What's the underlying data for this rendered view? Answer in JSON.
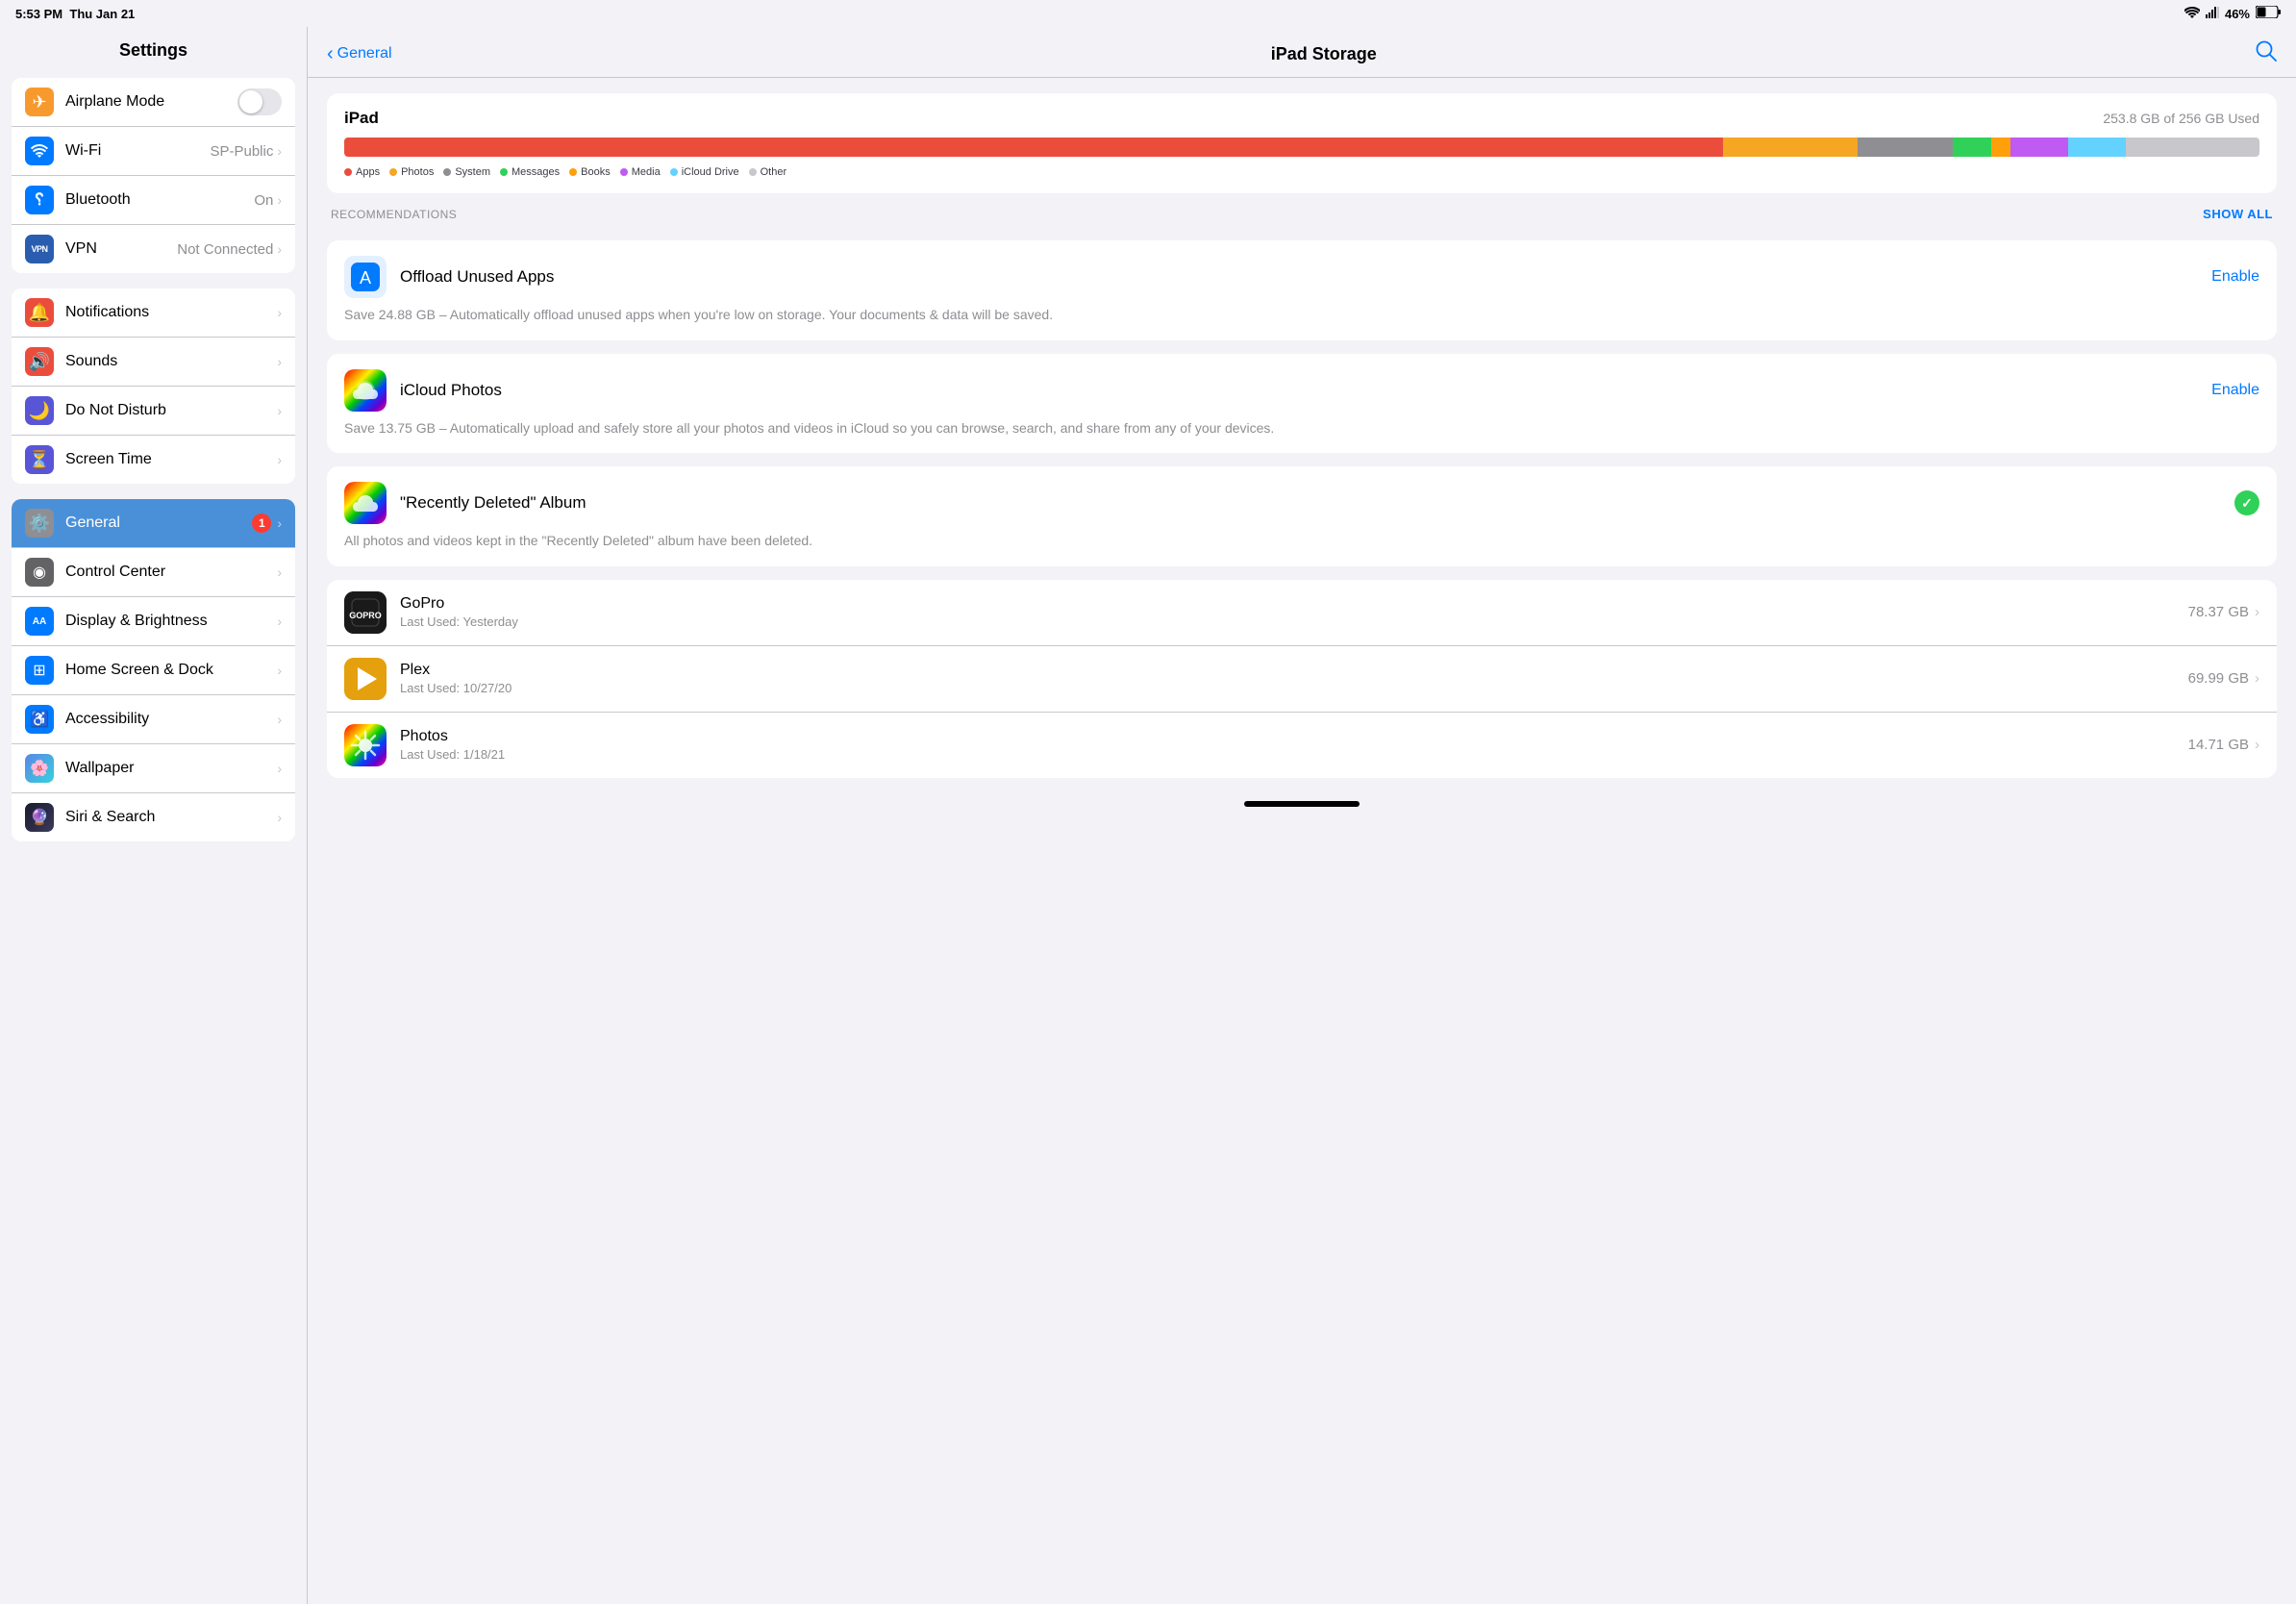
{
  "statusBar": {
    "time": "5:53 PM",
    "date": "Thu Jan 21",
    "wifi": "wifi",
    "signal": "signal",
    "battery": "46%"
  },
  "leftPanel": {
    "title": "Settings",
    "groups": [
      {
        "id": "connectivity",
        "rows": [
          {
            "id": "airplane",
            "icon": "✈️",
            "iconBg": "#f8992e",
            "label": "Airplane Mode",
            "type": "toggle",
            "toggleOn": false
          },
          {
            "id": "wifi",
            "icon": "📶",
            "iconBg": "#007aff",
            "label": "Wi-Fi",
            "value": "SP-Public",
            "type": "nav"
          },
          {
            "id": "bluetooth",
            "icon": "Ⓑ",
            "iconBg": "#007aff",
            "label": "Bluetooth",
            "value": "On",
            "type": "nav"
          },
          {
            "id": "vpn",
            "icon": "VPN",
            "iconBg": "#2a5db0",
            "label": "VPN",
            "value": "Not Connected",
            "type": "nav"
          }
        ]
      },
      {
        "id": "notifications",
        "rows": [
          {
            "id": "notifications",
            "icon": "🔔",
            "iconBg": "#eb4d3d",
            "label": "Notifications",
            "type": "nav"
          },
          {
            "id": "sounds",
            "icon": "🔊",
            "iconBg": "#eb4d3d",
            "label": "Sounds",
            "type": "nav"
          },
          {
            "id": "donotdisturb",
            "icon": "🌙",
            "iconBg": "#5856d6",
            "label": "Do Not Disturb",
            "type": "nav"
          },
          {
            "id": "screentime",
            "icon": "⏳",
            "iconBg": "#5856d6",
            "label": "Screen Time",
            "type": "nav"
          }
        ]
      },
      {
        "id": "general",
        "rows": [
          {
            "id": "general",
            "icon": "⚙️",
            "iconBg": "#8e8e93",
            "label": "General",
            "badge": "1",
            "type": "nav",
            "active": true
          },
          {
            "id": "controlcenter",
            "icon": "◉",
            "iconBg": "#636366",
            "label": "Control Center",
            "type": "nav"
          },
          {
            "id": "displaybrightness",
            "icon": "AA",
            "iconBg": "#007aff",
            "label": "Display & Brightness",
            "type": "nav"
          },
          {
            "id": "homescreendock",
            "icon": "⊞",
            "iconBg": "#007aff",
            "label": "Home Screen & Dock",
            "type": "nav"
          },
          {
            "id": "accessibility",
            "icon": "♿",
            "iconBg": "#007aff",
            "label": "Accessibility",
            "type": "nav"
          },
          {
            "id": "wallpaper",
            "icon": "🌸",
            "iconBg": "#007aff",
            "label": "Wallpaper",
            "type": "nav"
          },
          {
            "id": "sirisearch",
            "icon": "🔮",
            "iconBg": "#1a1a2e",
            "label": "Siri & Search",
            "type": "nav"
          }
        ]
      }
    ]
  },
  "rightPanel": {
    "backLabel": "General",
    "title": "iPad Storage",
    "storage": {
      "device": "iPad",
      "usageText": "253.8 GB of 256 GB Used",
      "bars": [
        {
          "id": "apps",
          "color": "#eb4d3d",
          "pct": 72
        },
        {
          "id": "photos",
          "color": "#f5a623",
          "pct": 7
        },
        {
          "id": "system",
          "color": "#8e8e93",
          "pct": 5
        },
        {
          "id": "messages",
          "color": "#30d158",
          "pct": 2
        },
        {
          "id": "books",
          "color": "#ff9f0a",
          "pct": 2
        },
        {
          "id": "media",
          "color": "#bf5af2",
          "pct": 3
        },
        {
          "id": "icloudDrive",
          "color": "#64d2ff",
          "pct": 3
        },
        {
          "id": "other",
          "color": "#c7c7cc",
          "pct": 5
        }
      ],
      "legend": [
        {
          "label": "Apps",
          "color": "#eb4d3d"
        },
        {
          "label": "Photos",
          "color": "#f5a623"
        },
        {
          "label": "System",
          "color": "#8e8e93"
        },
        {
          "label": "Messages",
          "color": "#30d158"
        },
        {
          "label": "Books",
          "color": "#ff9f0a"
        },
        {
          "label": "Media",
          "color": "#bf5af2"
        },
        {
          "label": "iCloud Drive",
          "color": "#64d2ff"
        },
        {
          "label": "Other",
          "color": "#c7c7cc"
        }
      ]
    },
    "recommendations": {
      "sectionLabel": "Recommendations",
      "showAllLabel": "SHOW ALL",
      "items": [
        {
          "id": "offload",
          "iconColor": "#007aff",
          "title": "Offload Unused Apps",
          "actionLabel": "Enable",
          "description": "Save 24.88 GB – Automatically offload unused apps when you're low on storage. Your documents & data will be saved.",
          "type": "action"
        },
        {
          "id": "icloudphotos",
          "title": "iCloud Photos",
          "actionLabel": "Enable",
          "description": "Save 13.75 GB – Automatically upload and safely store all your photos and videos in iCloud so you can browse, search, and share from any of your devices.",
          "type": "action"
        },
        {
          "id": "recentlydeleted",
          "title": "\"Recently Deleted\" Album",
          "description": "All photos and videos kept in the \"Recently Deleted\" album have been deleted.",
          "type": "done"
        }
      ]
    },
    "apps": [
      {
        "id": "gopro",
        "name": "GoPro",
        "lastUsed": "Last Used: Yesterday",
        "size": "78.37 GB",
        "iconColor": "#1a1a1a"
      },
      {
        "id": "plex",
        "name": "Plex",
        "lastUsed": "Last Used: 10/27/20",
        "size": "69.99 GB",
        "iconColor": "#e5a00d"
      },
      {
        "id": "photos",
        "name": "Photos",
        "lastUsed": "Last Used: 1/18/21",
        "size": "14.71 GB",
        "iconColor": "#ff9f0a"
      }
    ]
  }
}
